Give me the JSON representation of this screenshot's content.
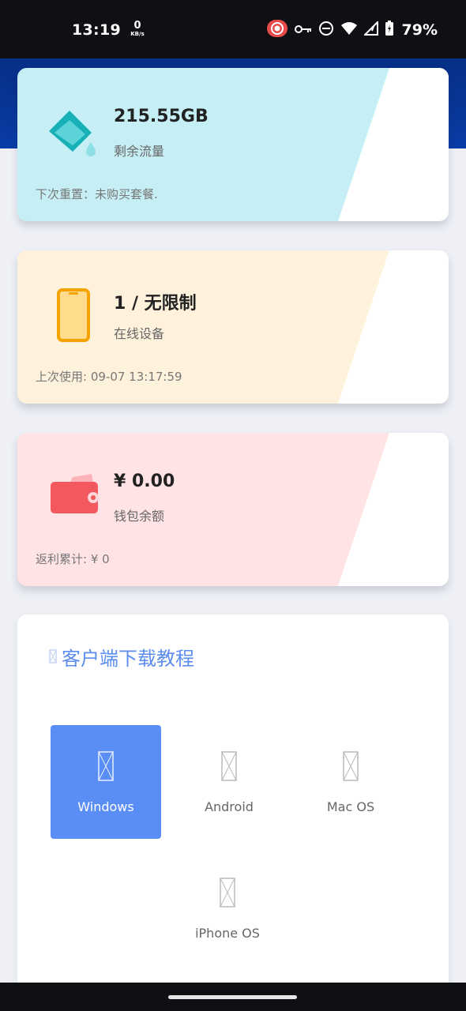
{
  "status_bar": {
    "time": "13:19",
    "net_speed_value": "0",
    "net_speed_unit": "KB/s",
    "battery": "79%",
    "icons": [
      "record-icon",
      "vpn-key-icon",
      "dnd-icon",
      "wifi-icon",
      "signal-icon",
      "battery-icon"
    ]
  },
  "cards": {
    "traffic": {
      "value": "215.55GB",
      "label": "剩余流量",
      "footer": "下次重置：未购买套餐.",
      "icon": "bucket-icon",
      "bg": "#c6eff5"
    },
    "devices": {
      "value": "1 / 无限制",
      "label": "在线设备",
      "footer": "上次使用: 09-07 13:17:59",
      "icon": "phone-icon",
      "bg": "#fff2dd"
    },
    "wallet": {
      "value": "¥ 0.00",
      "label": "钱包余额",
      "footer": "返利累计: ¥ 0",
      "icon": "wallet-icon",
      "bg": "#ffe3e5"
    }
  },
  "download": {
    "title": "客户端下载教程",
    "platforms": [
      {
        "name": "Windows",
        "active": true
      },
      {
        "name": "Android",
        "active": false
      },
      {
        "name": "Mac OS",
        "active": false
      },
      {
        "name": "iPhone OS",
        "active": false
      }
    ]
  },
  "colors": {
    "accent": "#5b8ef5",
    "header": "#0a3ca6",
    "background": "#eef0f6"
  }
}
